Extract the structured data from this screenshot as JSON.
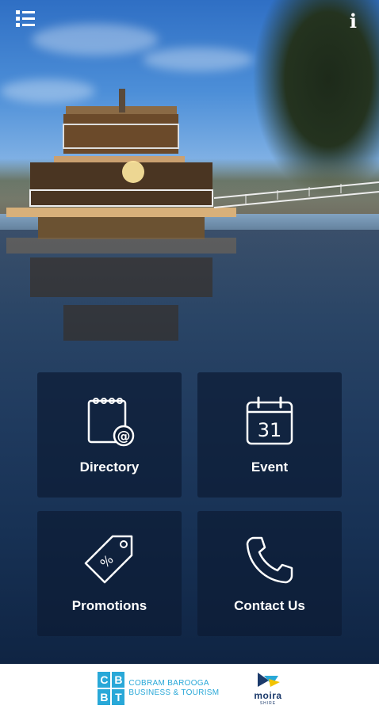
{
  "header": {
    "menu_icon": "menu-list-icon",
    "info_icon_label": "i"
  },
  "tiles": [
    {
      "label": "Directory",
      "icon": "directory-calendar-at-icon"
    },
    {
      "label": "Event",
      "icon": "calendar-31-icon",
      "icon_text": "31"
    },
    {
      "label": "Promotions",
      "icon": "percent-tag-icon"
    },
    {
      "label": "Contact Us",
      "icon": "phone-icon"
    }
  ],
  "footer": {
    "cbbt_letters": [
      "C",
      "B",
      "B",
      "T"
    ],
    "cbbt_line1": "COBRAM BAROOGA",
    "cbbt_line2": "BUSINESS & TOURISM",
    "moira_name": "moira",
    "moira_sub": "SHIRE"
  },
  "colors": {
    "accent": "#29a8d8",
    "tile_bg": "#0c1c34",
    "moira_navy": "#1b3a6b"
  }
}
